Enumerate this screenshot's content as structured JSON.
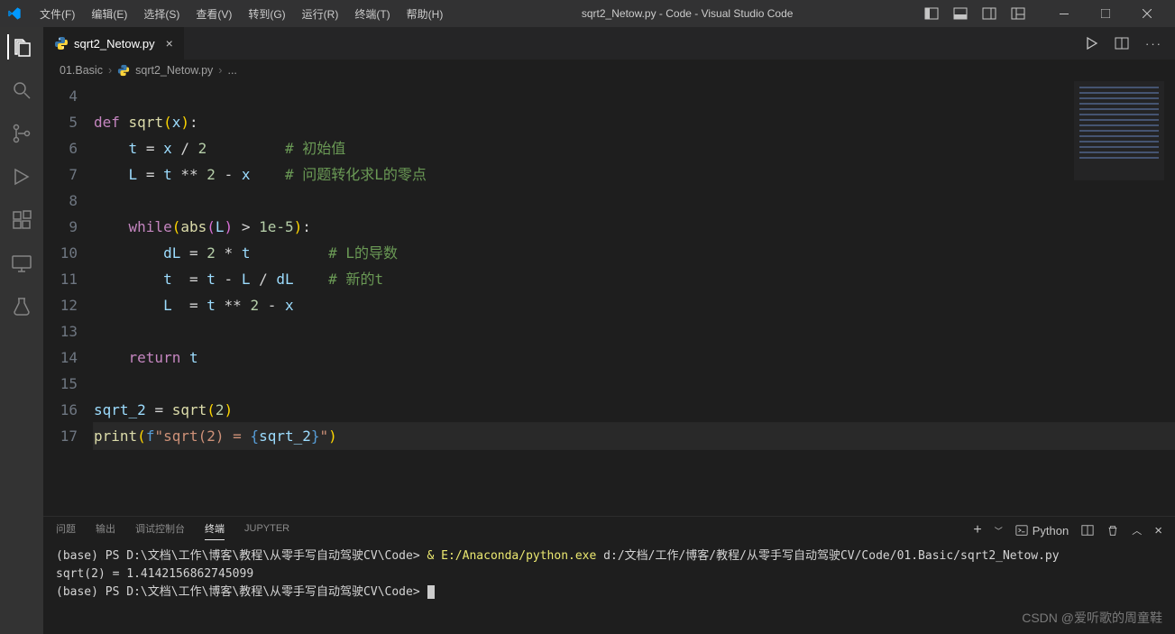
{
  "titlebar": {
    "menus": [
      "文件(F)",
      "编辑(E)",
      "选择(S)",
      "查看(V)",
      "转到(G)",
      "运行(R)",
      "终端(T)",
      "帮助(H)"
    ],
    "title": "sqrt2_Netow.py - Code - Visual Studio Code"
  },
  "tab": {
    "filename": "sqrt2_Netow.py"
  },
  "breadcrumbs": {
    "folder": "01.Basic",
    "file": "sqrt2_Netow.py",
    "extra": "..."
  },
  "gutter": {
    "start": 4,
    "end": 17
  },
  "code": {
    "lines": [
      {
        "n": 4,
        "html": ""
      },
      {
        "n": 5,
        "html": "<span class='kw'>def</span> <span class='fn'>sqrt</span><span class='pn'>(</span><span class='var'>x</span><span class='pn'>)</span>:"
      },
      {
        "n": 6,
        "html": "    <span class='var'>t</span> <span class='op'>=</span> <span class='var'>x</span> <span class='op'>/</span> <span class='num'>2</span>         <span class='cmt'># 初始值</span>"
      },
      {
        "n": 7,
        "html": "    <span class='var'>L</span> <span class='op'>=</span> <span class='var'>t</span> <span class='op'>**</span> <span class='num'>2</span> <span class='op'>-</span> <span class='var'>x</span>    <span class='cmt'># 问题转化求L的零点</span>"
      },
      {
        "n": 8,
        "html": ""
      },
      {
        "n": 9,
        "html": "    <span class='kw'>while</span><span class='pn'>(</span><span class='fn'>abs</span><span class='pn2'>(</span><span class='var'>L</span><span class='pn2'>)</span> <span class='op'>&gt;</span> <span class='num'>1e-5</span><span class='pn'>)</span>:"
      },
      {
        "n": 10,
        "html": "        <span class='var'>dL</span> <span class='op'>=</span> <span class='num'>2</span> <span class='op'>*</span> <span class='var'>t</span>         <span class='cmt'># L的导数</span>"
      },
      {
        "n": 11,
        "html": "        <span class='var'>t</span>  <span class='op'>=</span> <span class='var'>t</span> <span class='op'>-</span> <span class='var'>L</span> <span class='op'>/</span> <span class='var'>dL</span>    <span class='cmt'># 新的t</span>"
      },
      {
        "n": 12,
        "html": "        <span class='var'>L</span>  <span class='op'>=</span> <span class='var'>t</span> <span class='op'>**</span> <span class='num'>2</span> <span class='op'>-</span> <span class='var'>x</span>"
      },
      {
        "n": 13,
        "html": ""
      },
      {
        "n": 14,
        "html": "    <span class='kw'>return</span> <span class='var'>t</span>"
      },
      {
        "n": 15,
        "html": ""
      },
      {
        "n": 16,
        "html": "<span class='var'>sqrt_2</span> <span class='op'>=</span> <span class='fn'>sqrt</span><span class='pn'>(</span><span class='num'>2</span><span class='pn'>)</span>"
      },
      {
        "n": 17,
        "html": "<span class='fn'>print</span><span class='pn'>(</span><span class='cs'>f</span><span class='str'>\"sqrt(2) = </span><span class='cs'>{</span><span class='var'>sqrt_2</span><span class='cs'>}</span><span class='str'>\"</span><span class='pn'>)</span>"
      }
    ],
    "current_line": 17
  },
  "panel": {
    "tabs": [
      "问题",
      "输出",
      "调试控制台",
      "终端",
      "JUPYTER"
    ],
    "active": 3,
    "shell_label": "Python",
    "terminal": {
      "line1_pre": "(base) PS D:\\文档\\工作\\博客\\教程\\从零手写自动驾驶CV\\Code> ",
      "line1_cmd": "& E:/Anaconda/python.exe",
      "line1_post": " d:/文档/工作/博客/教程/从零手写自动驾驶CV/Code/01.Basic/sqrt2_Netow.py",
      "line2": "sqrt(2) = 1.4142156862745099",
      "line3": "(base) PS D:\\文档\\工作\\博客\\教程\\从零手写自动驾驶CV\\Code> "
    }
  },
  "watermark": "CSDN @爱听歌的周童鞋"
}
